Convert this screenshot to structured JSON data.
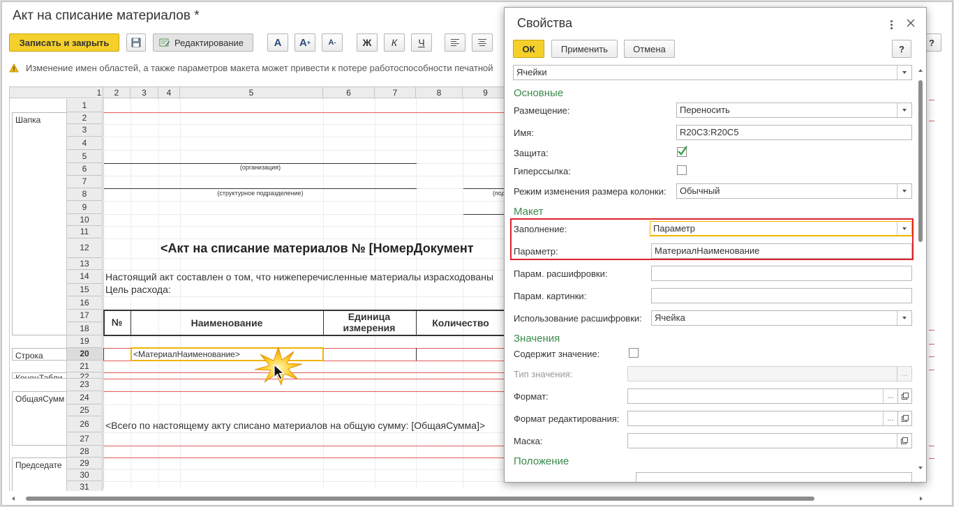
{
  "window": {
    "title": "Акт на списание материалов *",
    "save_close_label": "Записать и закрыть",
    "edit_label": "Редактирование",
    "fmt": {
      "font_larger": "A",
      "font_up": "A",
      "font_down": "A",
      "bold": "Ж",
      "italic": "К",
      "underline": "Ч"
    },
    "help_label": "?",
    "warning": "Изменение имен областей, а также параметров макета может привести к потере работоспособности печатной"
  },
  "sheet": {
    "col_headers": [
      "1",
      "2",
      "3",
      "4",
      "5",
      "6",
      "7",
      "8",
      "9"
    ],
    "row_headers": [
      "1",
      "2",
      "3",
      "4",
      "5",
      "6",
      "7",
      "8",
      "9",
      "10",
      "11",
      "12",
      "13",
      "14",
      "15",
      "16",
      "17",
      "18",
      "19",
      "20",
      "21",
      "22",
      "23",
      "24",
      "25",
      "26",
      "27",
      "28",
      "29",
      "30",
      "31"
    ],
    "active_row": "20",
    "areas": [
      "Шапка",
      "Строка",
      "КонецТабли",
      "ОбщаяСумм",
      "Председате"
    ],
    "org_caption": "(организация)",
    "dept_caption": "(структурное подразделение)",
    "dept_caption_right": "(под",
    "heading": "<Акт на списание материалов № [НомерДокумент",
    "text_line1": "Настоящий акт составлен о том, что нижеперечисленные материалы израсходованы",
    "text_line2": "Цель расхода:",
    "table_headers": {
      "num": "№",
      "name": "Наименование",
      "unit": "Единица измерения",
      "qty": "Количество"
    },
    "selected_cell": "<МатериалНаименование>",
    "total_line": "<Всего по настоящему акту списано материалов на общую сумму: [ОбщаяСумма]>"
  },
  "dialog": {
    "title": "Свойства",
    "ok": "ОК",
    "apply": "Применить",
    "cancel": "Отмена",
    "help": "?",
    "object_type": "Ячейки",
    "sections": {
      "basic": "Основные",
      "layout": "Макет",
      "values": "Значения",
      "position": "Положение"
    },
    "labels": {
      "placement": "Размещение:",
      "name": "Имя:",
      "protection": "Защита:",
      "hyperlink": "Гиперссылка:",
      "col_resize": "Режим изменения размера колонки:",
      "filling": "Заполнение:",
      "parameter": "Параметр:",
      "drill_param": "Парам. расшифровки:",
      "picture_param": "Парам. картинки:",
      "drill_use": "Использование расшифровки:",
      "contains_value": "Содержит значение:",
      "value_type": "Тип значения:",
      "format": "Формат:",
      "edit_format": "Формат редактирования:",
      "mask": "Маска:"
    },
    "values": {
      "placement": "Переносить",
      "name": "R20C3:R20C5",
      "protection": true,
      "hyperlink": false,
      "col_resize": "Обычный",
      "filling": "Параметр",
      "parameter": "МатериалНаименование",
      "drill_param": "",
      "picture_param": "",
      "drill_use": "Ячейка",
      "contains_value": false,
      "value_type": "",
      "format": "",
      "edit_format": "",
      "mask": ""
    },
    "ellipsis": "...",
    "highlight_color": "#e0202a",
    "accent_color": "#f0b400"
  }
}
